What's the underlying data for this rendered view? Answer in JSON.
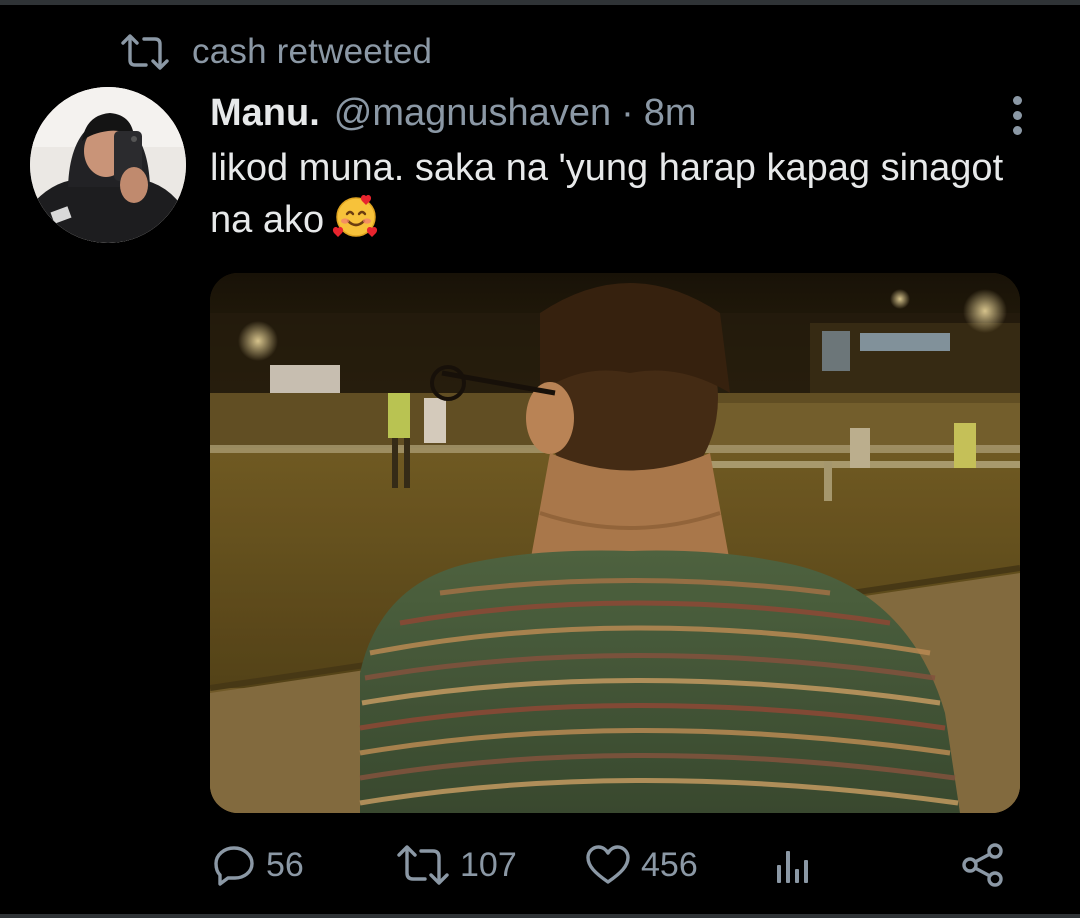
{
  "retweet_context": {
    "icon": "retweet-icon",
    "text": "cash retweeted"
  },
  "tweet": {
    "author_name": "Manu.",
    "author_handle": "@magnushaven",
    "separator": "·",
    "time": "8m",
    "text": "likod muna. saka na 'yung harap kapag sinagot na ako",
    "emoji": "smiling-face-with-hearts-emoji",
    "media": "photo-person-back-view-night"
  },
  "actions": {
    "replies": "56",
    "retweets": "107",
    "likes": "456"
  },
  "colors": {
    "background": "#000000",
    "text_primary": "#e7e9ea",
    "text_secondary": "#8b98a5",
    "divider": "#2f3336"
  }
}
